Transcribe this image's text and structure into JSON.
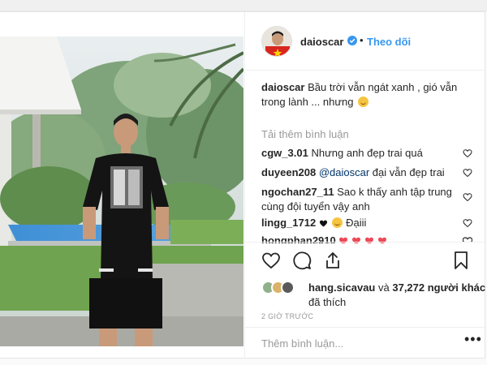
{
  "post": {
    "username": "daioscar",
    "follow_label": "Theo dõi",
    "separator": "•",
    "caption_user": "daioscar",
    "caption_text": "Bầu trời vẫn ngát xanh , gió vẫn trong lành ... nhưng",
    "load_more": "Tải thêm bình luận",
    "comments": [
      {
        "user": "cgw_3.01",
        "text": "Nhưng anh đẹp trai quá"
      },
      {
        "user": "duyeen208",
        "mention": "@daioscar",
        "text": "đại vẫn đẹp trai"
      },
      {
        "user": "ngochan27_11",
        "text": "Sao k thấy anh tập trung cùng đội tuyển vậy anh"
      },
      {
        "user": "lingg_1712",
        "text": "Đạiii"
      },
      {
        "user": "hongphan2910",
        "text": ""
      }
    ],
    "likes": {
      "first_user": "hang.sicavau",
      "joiner": "và",
      "count_text": "37,272 người khác",
      "suffix": "đã thích"
    },
    "time": "2 GIỜ TRƯỚC",
    "add_comment_placeholder": "Thêm bình luận...",
    "more_label": "•••"
  },
  "colors": {
    "accent": "#3897f0",
    "heart_red": "#ed4956",
    "text": "#262626",
    "muted": "#999999"
  },
  "icons": [
    "verified-badge-icon",
    "heart-icon",
    "comment-icon",
    "share-icon",
    "bookmark-icon",
    "more-options-icon"
  ]
}
